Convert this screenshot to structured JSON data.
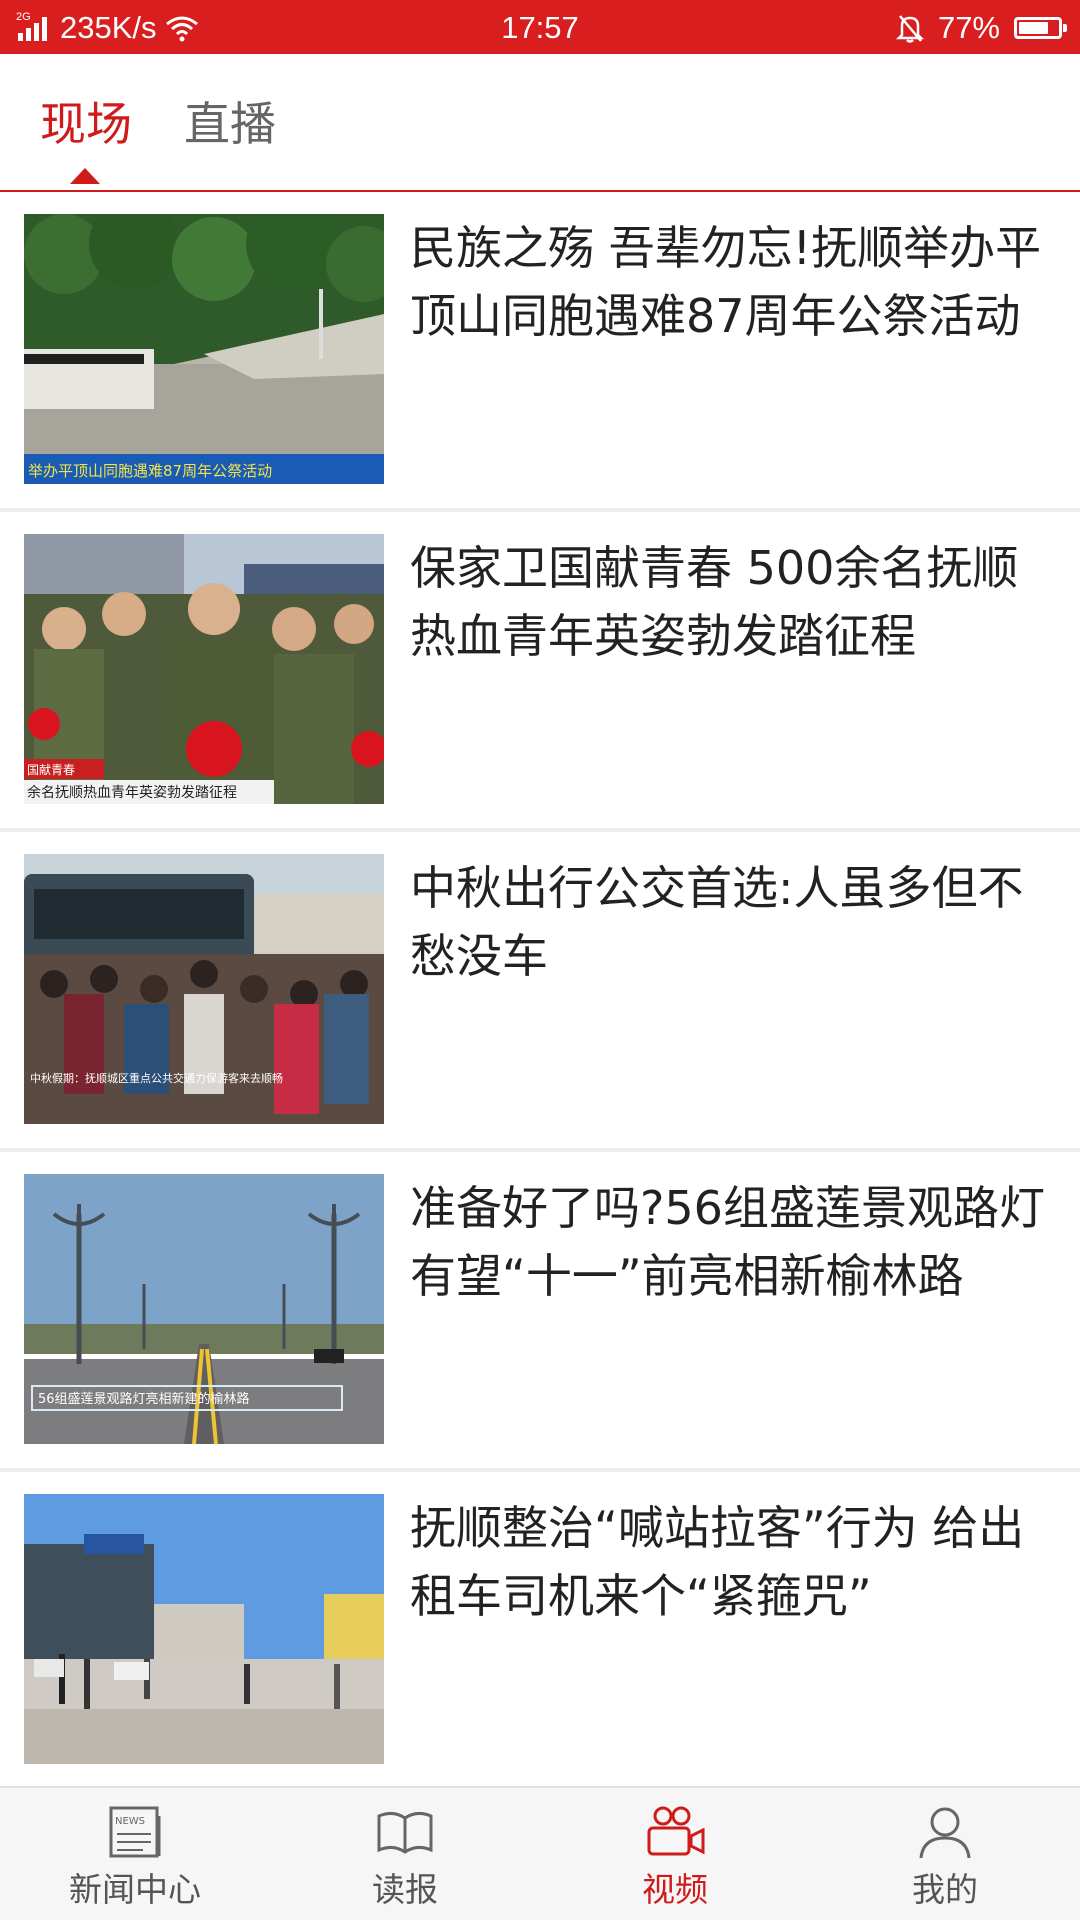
{
  "status_bar": {
    "network": "2G",
    "speed": "235K/s",
    "time": "17:57",
    "battery": "77%",
    "battery_level": 0.77,
    "icons": [
      "signal-icon",
      "wifi-icon",
      "bell-off-icon",
      "battery-icon"
    ]
  },
  "tabs": {
    "items": [
      {
        "label": "现场",
        "active": true
      },
      {
        "label": "直播",
        "active": false
      }
    ]
  },
  "news": [
    {
      "title": "民族之殇 吾辈勿忘!抚顺举办平顶山同胞遇难87周年公祭活动",
      "caption": "举办平顶山同胞遇难87周年公祭活动"
    },
    {
      "title": "保家卫国献青春 500余名抚顺热血青年英姿勃发踏征程",
      "caption_top": "国献青春",
      "caption": "余名抚顺热血青年英姿勃发踏征程"
    },
    {
      "title": "中秋出行公交首选:人虽多但不愁没车",
      "caption": "中秋假期：抚顺城区重点公共交通力保游客来去顺畅"
    },
    {
      "title": "准备好了吗?56组盛莲景观路灯有望“十一”前亮相新榆林路",
      "caption": "56组盛莲景观路灯亮相新建的榆林路"
    },
    {
      "title": "抚顺整治“喊站拉客”行为 给出租车司机来个“紧箍咒”",
      "caption": ""
    }
  ],
  "bottom_nav": {
    "items": [
      {
        "label": "新闻中心",
        "icon": "news-icon",
        "active": false
      },
      {
        "label": "读报",
        "icon": "book-icon",
        "active": false
      },
      {
        "label": "视频",
        "icon": "video-camera-icon",
        "active": true
      },
      {
        "label": "我的",
        "icon": "user-icon",
        "active": false
      }
    ]
  },
  "colors": {
    "accent": "#cf1b1b",
    "status_bar": "#d81e1e",
    "text": "#222222",
    "inactive": "#666666"
  }
}
